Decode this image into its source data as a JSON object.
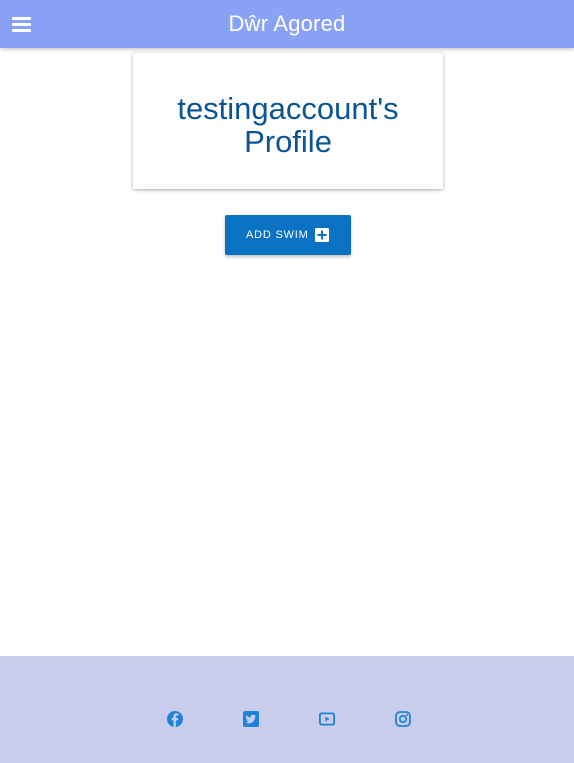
{
  "header": {
    "menu_icon": "hamburger-menu-icon",
    "title": "Dŵr Agored"
  },
  "profile": {
    "title": "testingaccount's Profile"
  },
  "actions": {
    "add_swim_label": "Add Swim",
    "add_swim_icon": "add-box-icon"
  },
  "footer": {
    "social": [
      {
        "name": "facebook",
        "icon": "facebook-icon"
      },
      {
        "name": "twitter",
        "icon": "twitter-icon"
      },
      {
        "name": "youtube",
        "icon": "youtube-icon"
      },
      {
        "name": "instagram",
        "icon": "instagram-icon"
      }
    ]
  },
  "colors": {
    "header_bg": "#8aa2f6",
    "title_text": "#0a5595",
    "button_bg": "#0a72c2",
    "footer_bg": "#c7cdea",
    "social_icon": "#1f82d9"
  }
}
